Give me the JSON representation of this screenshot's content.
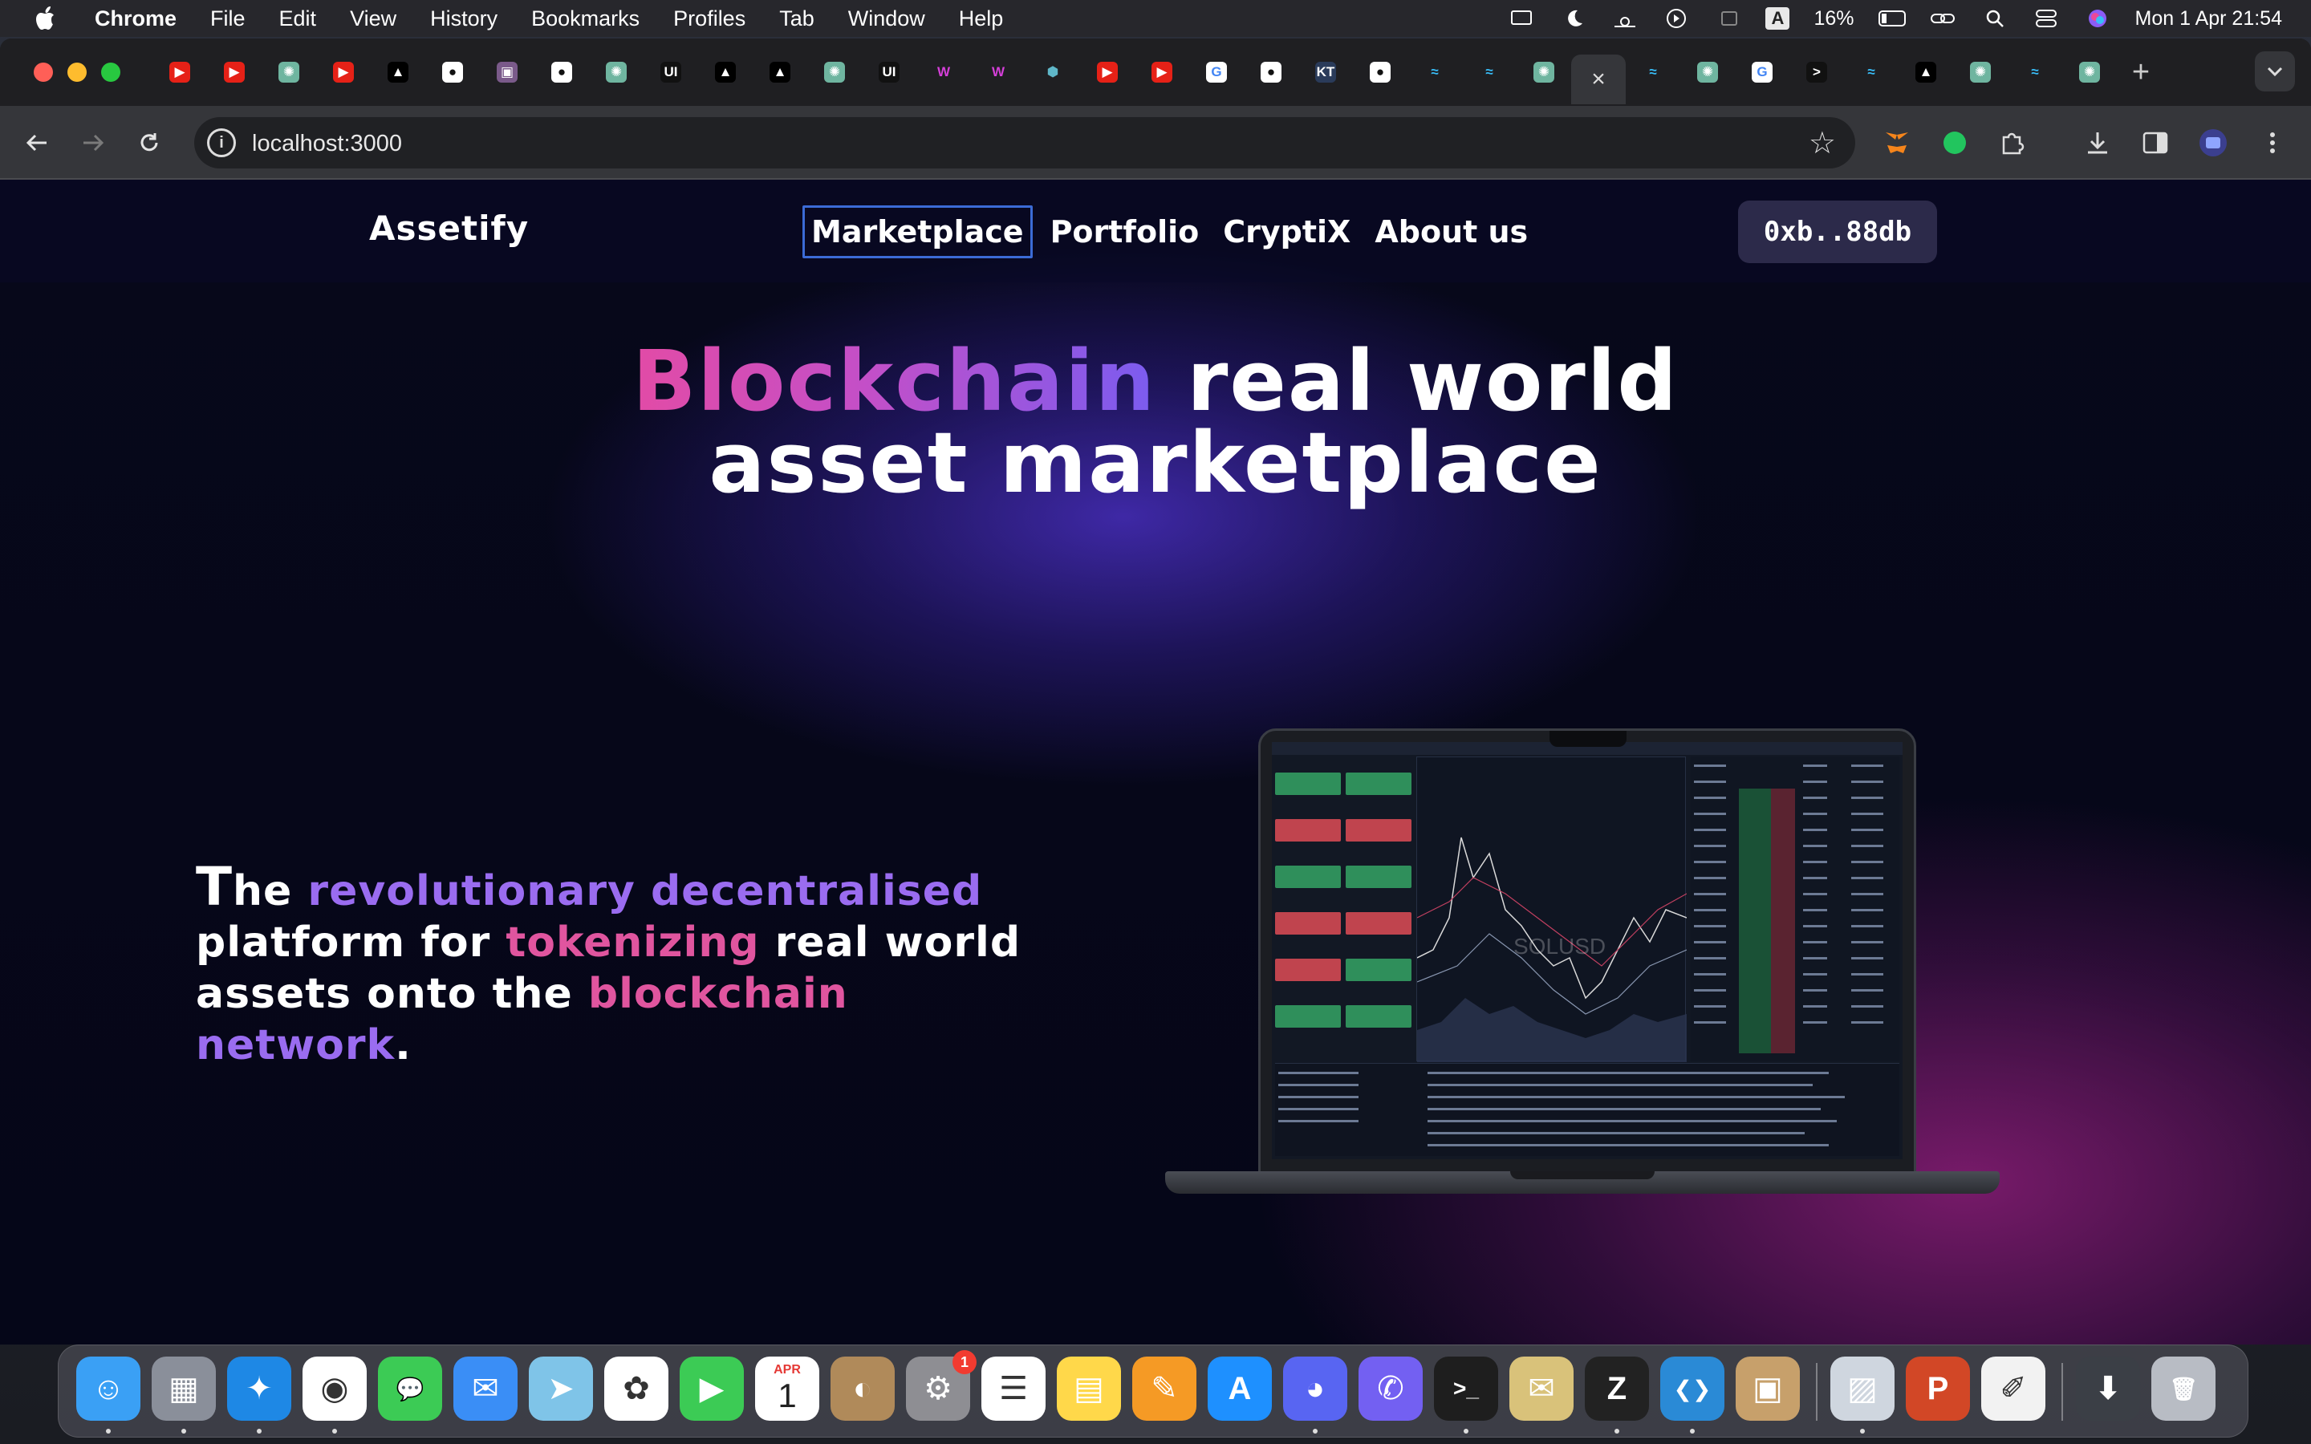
{
  "menubar": {
    "app_name": "Chrome",
    "items": [
      "File",
      "Edit",
      "View",
      "History",
      "Bookmarks",
      "Profiles",
      "Tab",
      "Window",
      "Help"
    ],
    "input_indicator": "A",
    "battery_percent": "16%",
    "datetime": "Mon 1 Apr  21:54"
  },
  "browser": {
    "url": "localhost:3000",
    "active_tab_close": "×",
    "new_tab": "+",
    "tab_favicons": [
      "youtube-icon",
      "youtube-icon",
      "chatgpt-icon",
      "youtube-icon",
      "vercel-icon",
      "github-icon",
      "image-icon",
      "github-icon",
      "chatgpt-icon",
      "ui-icon",
      "vercel-icon",
      "vercel-icon",
      "chatgpt-icon",
      "ui-icon",
      "w-icon",
      "w-icon",
      "cube-icon",
      "youtube-icon",
      "youtube-icon",
      "google-icon",
      "github-icon",
      "kt-icon",
      "github-icon",
      "tailwind-icon",
      "tailwind-icon",
      "chatgpt-icon",
      "close-icon",
      "tailwind-icon",
      "chatgpt-icon",
      "google-icon",
      "terminal-icon",
      "tailwind-icon",
      "vercel-icon",
      "chatgpt-icon",
      "tailwind-icon",
      "chatgpt-icon"
    ],
    "tab_labels": {
      "ui": "UI",
      "kt": "KT",
      "terminal": ">",
      "w": "W"
    }
  },
  "site": {
    "brand": "Assetify",
    "nav": [
      "Marketplace",
      "Portfolio",
      "CryptiX",
      "About us"
    ],
    "wallet": "0xb..88db",
    "hero": {
      "title_highlight": "Blockchain",
      "title_rest_1": " real world",
      "title_line_2": "asset marketplace"
    },
    "description": {
      "first_letter": "T",
      "p1": "he ",
      "p2": "revolutionary decentralised",
      "p3": "platform for ",
      "p4": "tokenizing",
      "p5": " real world assets onto the ",
      "p6": "blockchain",
      "p7": "network",
      "p8": "."
    },
    "laptop_screen_label": "SOLUSD",
    "colors": {
      "pink": "#e0559f",
      "purple": "#9a6cf0",
      "focus": "#3b6bd6"
    }
  },
  "dock": {
    "apps": [
      "finder-icon",
      "launchpad-icon",
      "safari-icon",
      "chrome-icon",
      "messages-icon",
      "mail-icon",
      "maps-icon",
      "photos-icon",
      "facetime-icon",
      "calendar-icon",
      "contacts-icon",
      "system-settings-icon",
      "reminders-icon",
      "notes-icon",
      "pages-icon",
      "app-store-icon",
      "discord-icon",
      "viber-icon",
      "terminal-icon",
      "mail-app-icon",
      "zed-icon",
      "vscode-icon",
      "box-icon",
      "preview-icon",
      "powerpoint-icon",
      "textedit-icon",
      "downloads-icon",
      "trash-icon"
    ],
    "calendar_month": "APR",
    "calendar_day": "1",
    "settings_badge": "1"
  }
}
